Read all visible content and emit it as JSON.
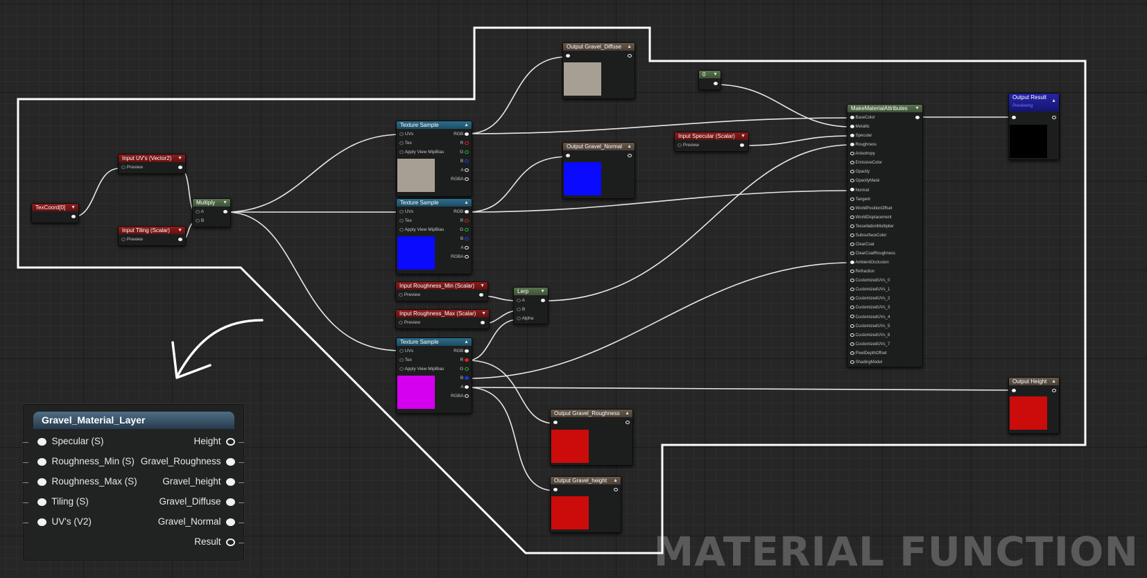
{
  "watermark": "MATERIAL FUNCTION",
  "nodes": {
    "texcoord": {
      "title": "TexCoord[0]"
    },
    "input_uvs": {
      "title": "Input UV's (Vector2)",
      "pin": "Preview"
    },
    "input_tiling": {
      "title": "Input Tiling (Scalar)",
      "pin": "Preview"
    },
    "multiply": {
      "title": "Multiply",
      "pin_a": "A",
      "pin_b": "B"
    },
    "texture_sample": {
      "title": "Texture Sample",
      "inputs": [
        "UVs",
        "Tex",
        "Apply View MipBias"
      ],
      "outputs": [
        "RGB",
        "R",
        "G",
        "B",
        "A",
        "RGBA"
      ]
    },
    "input_rough_min": {
      "title": "Input Roughness_Min (Scalar)",
      "pin": "Preview"
    },
    "input_rough_max": {
      "title": "Input Roughness_Max (Scalar)",
      "pin": "Preview"
    },
    "lerp": {
      "title": "Lerp",
      "pins": [
        "A",
        "B",
        "Alpha"
      ]
    },
    "out_diffuse": {
      "title": "Output Gravel_Diffuse"
    },
    "out_normal": {
      "title": "Output Gravel_Normal"
    },
    "out_roughness": {
      "title": "Output Gravel_Roughness"
    },
    "out_height": {
      "title": "Output Gravel_height"
    },
    "const_zero": {
      "title": "0"
    },
    "input_specular": {
      "title": "Input Specular (Scalar)",
      "pin": "Preview"
    },
    "make_material": {
      "title": "MakeMaterialAttributes",
      "pins": [
        "BaseColor",
        "Metallic",
        "Specular",
        "Roughness",
        "Anisotropy",
        "EmissiveColor",
        "Opacity",
        "OpacityMask",
        "Normal",
        "Tangent",
        "WorldPositionOffset",
        "WorldDisplacement",
        "TessellationMultiplier",
        "SubsurfaceColor",
        "ClearCoat",
        "ClearCoatRoughness",
        "AmbientOcclusion",
        "Refraction",
        "CustomizedUVs_0",
        "CustomizedUVs_1",
        "CustomizedUVs_2",
        "CustomizedUVs_3",
        "CustomizedUVs_4",
        "CustomizedUVs_5",
        "CustomizedUVs_6",
        "CustomizedUVs_7",
        "PixelDepthOffset",
        "ShadingModel"
      ]
    },
    "output_result": {
      "title": "Output Result",
      "subtitle": "Previewing"
    },
    "output_height_node": {
      "title": "Output Height"
    }
  },
  "layer_node": {
    "title": "Gravel_Material_Layer",
    "inputs": [
      "Specular (S)",
      "Roughness_Min (S)",
      "Roughness_Max (S)",
      "Tiling (S)",
      "UV's (V2)"
    ],
    "outputs": [
      "Height",
      "Gravel_Roughness",
      "Gravel_height",
      "Gravel_Diffuse",
      "Gravel_Normal",
      "Result"
    ]
  },
  "colors": {
    "diffuse_preview": "#a89f94",
    "normal_preview": "#0a0aff",
    "mask_preview": "#d400ef",
    "red_preview": "#cc0b0b",
    "black_preview": "#000000",
    "outline": "#ffffff"
  }
}
